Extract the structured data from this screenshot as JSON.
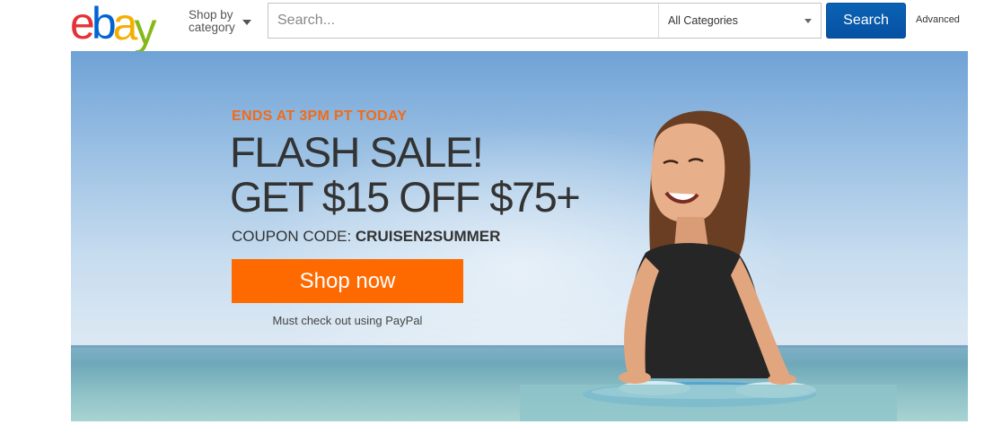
{
  "header": {
    "logo": {
      "letters": [
        "e",
        "b",
        "a",
        "y"
      ],
      "colors": [
        "#e53238",
        "#0064d2",
        "#f5af02",
        "#86b817"
      ]
    },
    "shop_by_category": "Shop by category",
    "search": {
      "placeholder": "Search..."
    },
    "category_select": {
      "selected": "All Categories"
    },
    "search_button": "Search",
    "advanced_link": "Advanced"
  },
  "banner": {
    "ends_text": "ENDS AT 3PM PT TODAY",
    "headline_line1": "FLASH SALE!",
    "headline_line2": "GET $15 OFF $75+",
    "coupon_label": "COUPON CODE: ",
    "coupon_code": "CRUISEN2SUMMER",
    "cta_button": "Shop now",
    "note": "Must check out using PayPal",
    "accent_color": "#f26b18",
    "button_color": "#ff6a00"
  },
  "colors": {
    "search_button_bg": "#0654ba"
  }
}
